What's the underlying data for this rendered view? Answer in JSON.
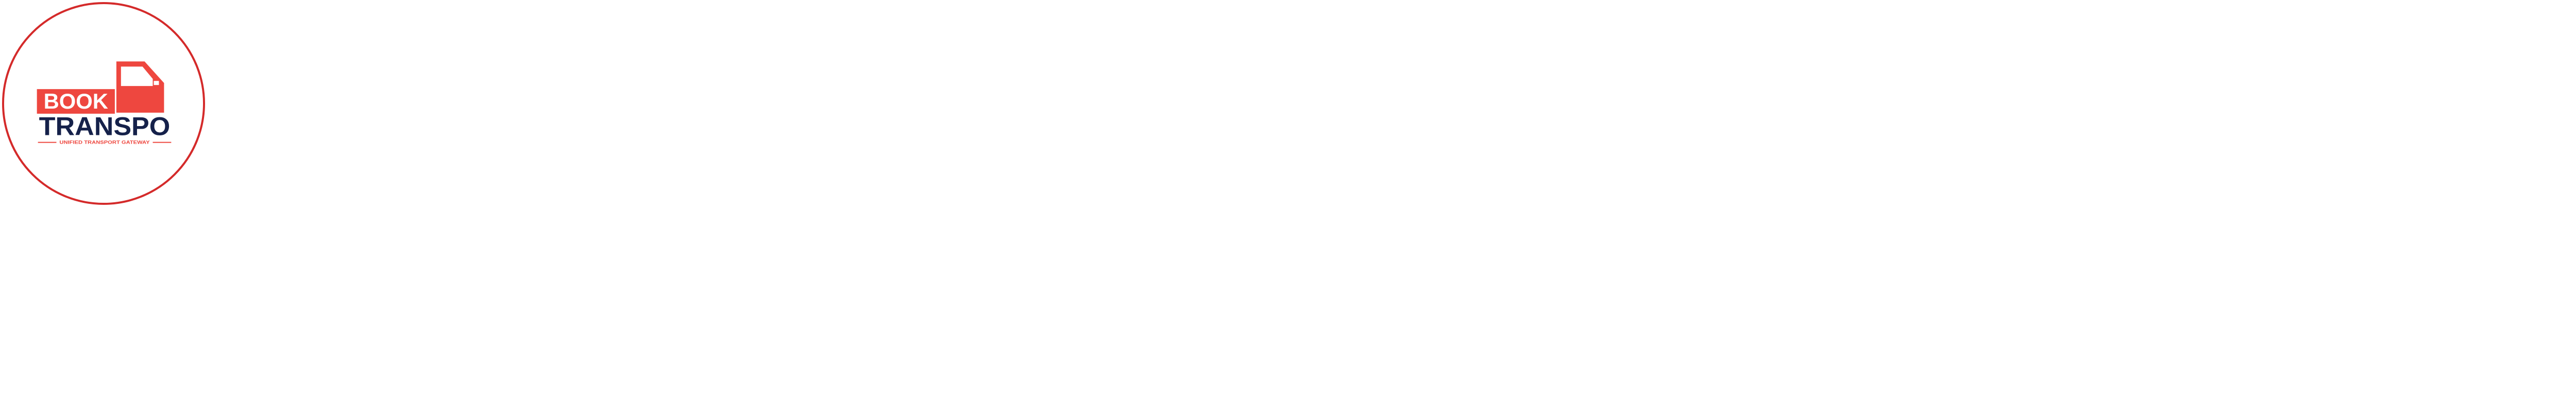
{
  "logo": {
    "word_book": "BOOK",
    "word_transpo": "TRANSPO",
    "tagline": "UNIFIED TRANSPORT GATEWAY",
    "icon": "truck-icon",
    "colors": {
      "ring": "#d42a2a",
      "brand_red": "#ee473f",
      "navy": "#15214a",
      "background": "#ffffff"
    }
  }
}
